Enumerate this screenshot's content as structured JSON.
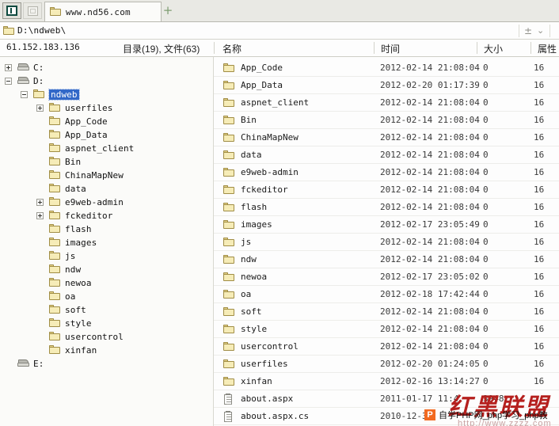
{
  "tabbar": {
    "window_button": "window-restore",
    "second_button": "window-tile",
    "tab_label": "www.nd56.com",
    "new_tab": "+"
  },
  "address": {
    "path": "D:\\ndweb\\",
    "minmax": "±",
    "chevron": "⌄"
  },
  "columns": {
    "ip": "61.152.183.136",
    "count": "目录(19), 文件(63)",
    "name": "名称",
    "time": "时间",
    "size": "大小",
    "attr": "属性"
  },
  "tree": [
    {
      "label": "C:",
      "type": "drive",
      "depth": 0,
      "expander": "plus",
      "selected": false
    },
    {
      "label": "D:",
      "type": "drive",
      "depth": 0,
      "expander": "minus",
      "selected": false
    },
    {
      "label": "ndweb",
      "type": "folder",
      "depth": 1,
      "expander": "minus",
      "selected": true
    },
    {
      "label": "userfiles",
      "type": "folder",
      "depth": 2,
      "expander": "plus",
      "selected": false
    },
    {
      "label": "App_Code",
      "type": "folder",
      "depth": 2,
      "expander": "none",
      "selected": false
    },
    {
      "label": "App_Data",
      "type": "folder",
      "depth": 2,
      "expander": "none",
      "selected": false
    },
    {
      "label": "aspnet_client",
      "type": "folder",
      "depth": 2,
      "expander": "none",
      "selected": false
    },
    {
      "label": "Bin",
      "type": "folder",
      "depth": 2,
      "expander": "none",
      "selected": false
    },
    {
      "label": "ChinaMapNew",
      "type": "folder",
      "depth": 2,
      "expander": "none",
      "selected": false
    },
    {
      "label": "data",
      "type": "folder",
      "depth": 2,
      "expander": "none",
      "selected": false
    },
    {
      "label": "e9web-admin",
      "type": "folder",
      "depth": 2,
      "expander": "plus",
      "selected": false
    },
    {
      "label": "fckeditor",
      "type": "folder",
      "depth": 2,
      "expander": "plus",
      "selected": false
    },
    {
      "label": "flash",
      "type": "folder",
      "depth": 2,
      "expander": "none",
      "selected": false
    },
    {
      "label": "images",
      "type": "folder",
      "depth": 2,
      "expander": "none",
      "selected": false
    },
    {
      "label": "js",
      "type": "folder",
      "depth": 2,
      "expander": "none",
      "selected": false
    },
    {
      "label": "ndw",
      "type": "folder",
      "depth": 2,
      "expander": "none",
      "selected": false
    },
    {
      "label": "newoa",
      "type": "folder",
      "depth": 2,
      "expander": "none",
      "selected": false
    },
    {
      "label": "oa",
      "type": "folder",
      "depth": 2,
      "expander": "none",
      "selected": false
    },
    {
      "label": "soft",
      "type": "folder",
      "depth": 2,
      "expander": "none",
      "selected": false
    },
    {
      "label": "style",
      "type": "folder",
      "depth": 2,
      "expander": "none",
      "selected": false
    },
    {
      "label": "usercontrol",
      "type": "folder",
      "depth": 2,
      "expander": "none",
      "selected": false
    },
    {
      "label": "xinfan",
      "type": "folder",
      "depth": 2,
      "expander": "none",
      "selected": false
    },
    {
      "label": "E:",
      "type": "drive",
      "depth": 0,
      "expander": "none",
      "selected": false
    }
  ],
  "files": [
    {
      "name": "App_Code",
      "type": "folder",
      "time": "2012-02-14 21:08:04",
      "size": "0",
      "attr": "16"
    },
    {
      "name": "App_Data",
      "type": "folder",
      "time": "2012-02-20 01:17:39",
      "size": "0",
      "attr": "16"
    },
    {
      "name": "aspnet_client",
      "type": "folder",
      "time": "2012-02-14 21:08:04",
      "size": "0",
      "attr": "16"
    },
    {
      "name": "Bin",
      "type": "folder",
      "time": "2012-02-14 21:08:04",
      "size": "0",
      "attr": "16"
    },
    {
      "name": "ChinaMapNew",
      "type": "folder",
      "time": "2012-02-14 21:08:04",
      "size": "0",
      "attr": "16"
    },
    {
      "name": "data",
      "type": "folder",
      "time": "2012-02-14 21:08:04",
      "size": "0",
      "attr": "16"
    },
    {
      "name": "e9web-admin",
      "type": "folder",
      "time": "2012-02-14 21:08:04",
      "size": "0",
      "attr": "16"
    },
    {
      "name": "fckeditor",
      "type": "folder",
      "time": "2012-02-14 21:08:04",
      "size": "0",
      "attr": "16"
    },
    {
      "name": "flash",
      "type": "folder",
      "time": "2012-02-14 21:08:04",
      "size": "0",
      "attr": "16"
    },
    {
      "name": "images",
      "type": "folder",
      "time": "2012-02-17 23:05:49",
      "size": "0",
      "attr": "16"
    },
    {
      "name": "js",
      "type": "folder",
      "time": "2012-02-14 21:08:04",
      "size": "0",
      "attr": "16"
    },
    {
      "name": "ndw",
      "type": "folder",
      "time": "2012-02-14 21:08:04",
      "size": "0",
      "attr": "16"
    },
    {
      "name": "newoa",
      "type": "folder",
      "time": "2012-02-17 23:05:02",
      "size": "0",
      "attr": "16"
    },
    {
      "name": "oa",
      "type": "folder",
      "time": "2012-02-18 17:42:44",
      "size": "0",
      "attr": "16"
    },
    {
      "name": "soft",
      "type": "folder",
      "time": "2012-02-14 21:08:04",
      "size": "0",
      "attr": "16"
    },
    {
      "name": "style",
      "type": "folder",
      "time": "2012-02-14 21:08:04",
      "size": "0",
      "attr": "16"
    },
    {
      "name": "usercontrol",
      "type": "folder",
      "time": "2012-02-14 21:08:04",
      "size": "0",
      "attr": "16"
    },
    {
      "name": "userfiles",
      "type": "folder",
      "time": "2012-02-20 01:24:05",
      "size": "0",
      "attr": "16"
    },
    {
      "name": "xinfan",
      "type": "folder",
      "time": "2012-02-16 13:14:27",
      "size": "0",
      "attr": "16"
    },
    {
      "name": "about.aspx",
      "type": "file",
      "time": "2011-01-17 11:4",
      "size": "3948",
      "attr": ""
    },
    {
      "name": "about.aspx.cs",
      "type": "file",
      "time": "2010-12-3",
      "size": "",
      "attr": ""
    }
  ],
  "watermark": {
    "cn_text": "红黑联盟",
    "logo": "P",
    "site_text": "自学PHP网_php学习_php教",
    "url": "http://www.zzzz.com"
  }
}
